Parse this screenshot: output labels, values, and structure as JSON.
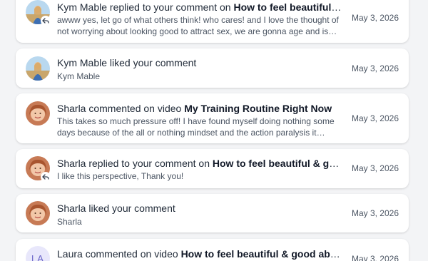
{
  "notifications": [
    {
      "actor": "Kym Mable",
      "action": "replied to your comment on",
      "target": "How to feel beautiful & good about yourself",
      "snippet": "awww yes, let go of what others think!  who cares!  and I love the thought of not worrying about looking good to attract sex, we are gonna age and is th...",
      "date": "May 3, 2026",
      "avatar": "kym-photo",
      "badge_icon": "reply-icon"
    },
    {
      "actor": "Kym Mable",
      "action": "liked your comment",
      "subtitle": "Kym Mable",
      "date": "May 3, 2026",
      "avatar": "kym-photo"
    },
    {
      "actor": "Sharla",
      "action": "commented on video",
      "target": "My Training Routine Right Now",
      "snippet": "This takes so much pressure off! I have found myself doing nothing some days because of the all or nothing mindset and the action paralysis it cause...",
      "date": "May 3, 2026",
      "avatar": "sharla-photo"
    },
    {
      "actor": "Sharla",
      "action": "replied to your comment on",
      "target": "How to feel beautiful & good about yourself",
      "snippet": "I like this perspective, Thank you!",
      "date": "May 3, 2026",
      "avatar": "sharla-photo",
      "badge_icon": "reply-icon"
    },
    {
      "actor": "Sharla",
      "action": "liked your comment",
      "subtitle": "Sharla",
      "date": "May 3, 2026",
      "avatar": "sharla-photo"
    },
    {
      "actor": "Laura",
      "action": "commented on video",
      "target": "How to feel beautiful & good about yourself",
      "date": "May 3, 2026",
      "avatar_initials": "LA"
    }
  ]
}
